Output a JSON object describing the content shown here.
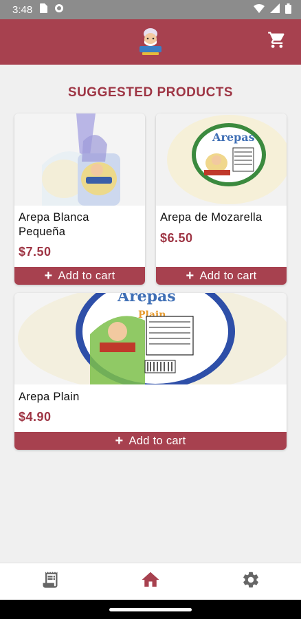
{
  "status_bar": {
    "time": "3:48",
    "icons": [
      "sim-card-icon",
      "sync-icon",
      "wifi-icon",
      "signal-icon",
      "battery-icon"
    ]
  },
  "app_bar": {
    "logo": "brand-logo",
    "cart_icon": "shopping-cart-icon",
    "color": "#a7414f"
  },
  "section_title": "SUGGESTED PRODUCTS",
  "products": [
    {
      "name_line1": "Arepa Blanca",
      "name_line2": "Pequeña",
      "price": "$7.50",
      "button": "Add to cart"
    },
    {
      "name_line1": "Arepa de Mozarella",
      "name_line2": "",
      "price": "$6.50",
      "button": "Add to cart"
    },
    {
      "name_line1": "Arepa Plain",
      "name_line2": "",
      "price": "$4.90",
      "button": "Add to cart"
    }
  ],
  "bottom_nav": {
    "items": [
      {
        "icon": "orders-icon",
        "active": false
      },
      {
        "icon": "home-icon",
        "active": true
      },
      {
        "icon": "settings-icon",
        "active": false
      }
    ],
    "active_color": "#a7414f",
    "inactive_color": "#666666"
  }
}
